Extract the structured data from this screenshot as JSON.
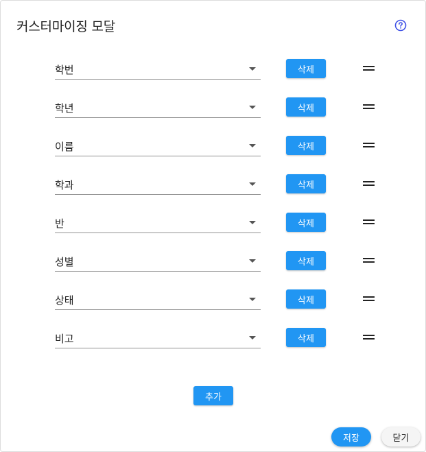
{
  "modal": {
    "title": "커스터마이징 모달",
    "help_icon": "help-circle-icon"
  },
  "rows": [
    {
      "value": "학번",
      "delete_label": "삭제"
    },
    {
      "value": "학년",
      "delete_label": "삭제"
    },
    {
      "value": "이름",
      "delete_label": "삭제"
    },
    {
      "value": "학과",
      "delete_label": "삭제"
    },
    {
      "value": "반",
      "delete_label": "삭제"
    },
    {
      "value": "성별",
      "delete_label": "삭제"
    },
    {
      "value": "상태",
      "delete_label": "삭제"
    },
    {
      "value": "비고",
      "delete_label": "삭제"
    }
  ],
  "actions": {
    "add_label": "추가",
    "save_label": "저장",
    "close_label": "닫기"
  },
  "colors": {
    "primary": "#2196f3",
    "help_icon": "#3f51e6",
    "secondary_button": "#f5f5f5"
  }
}
